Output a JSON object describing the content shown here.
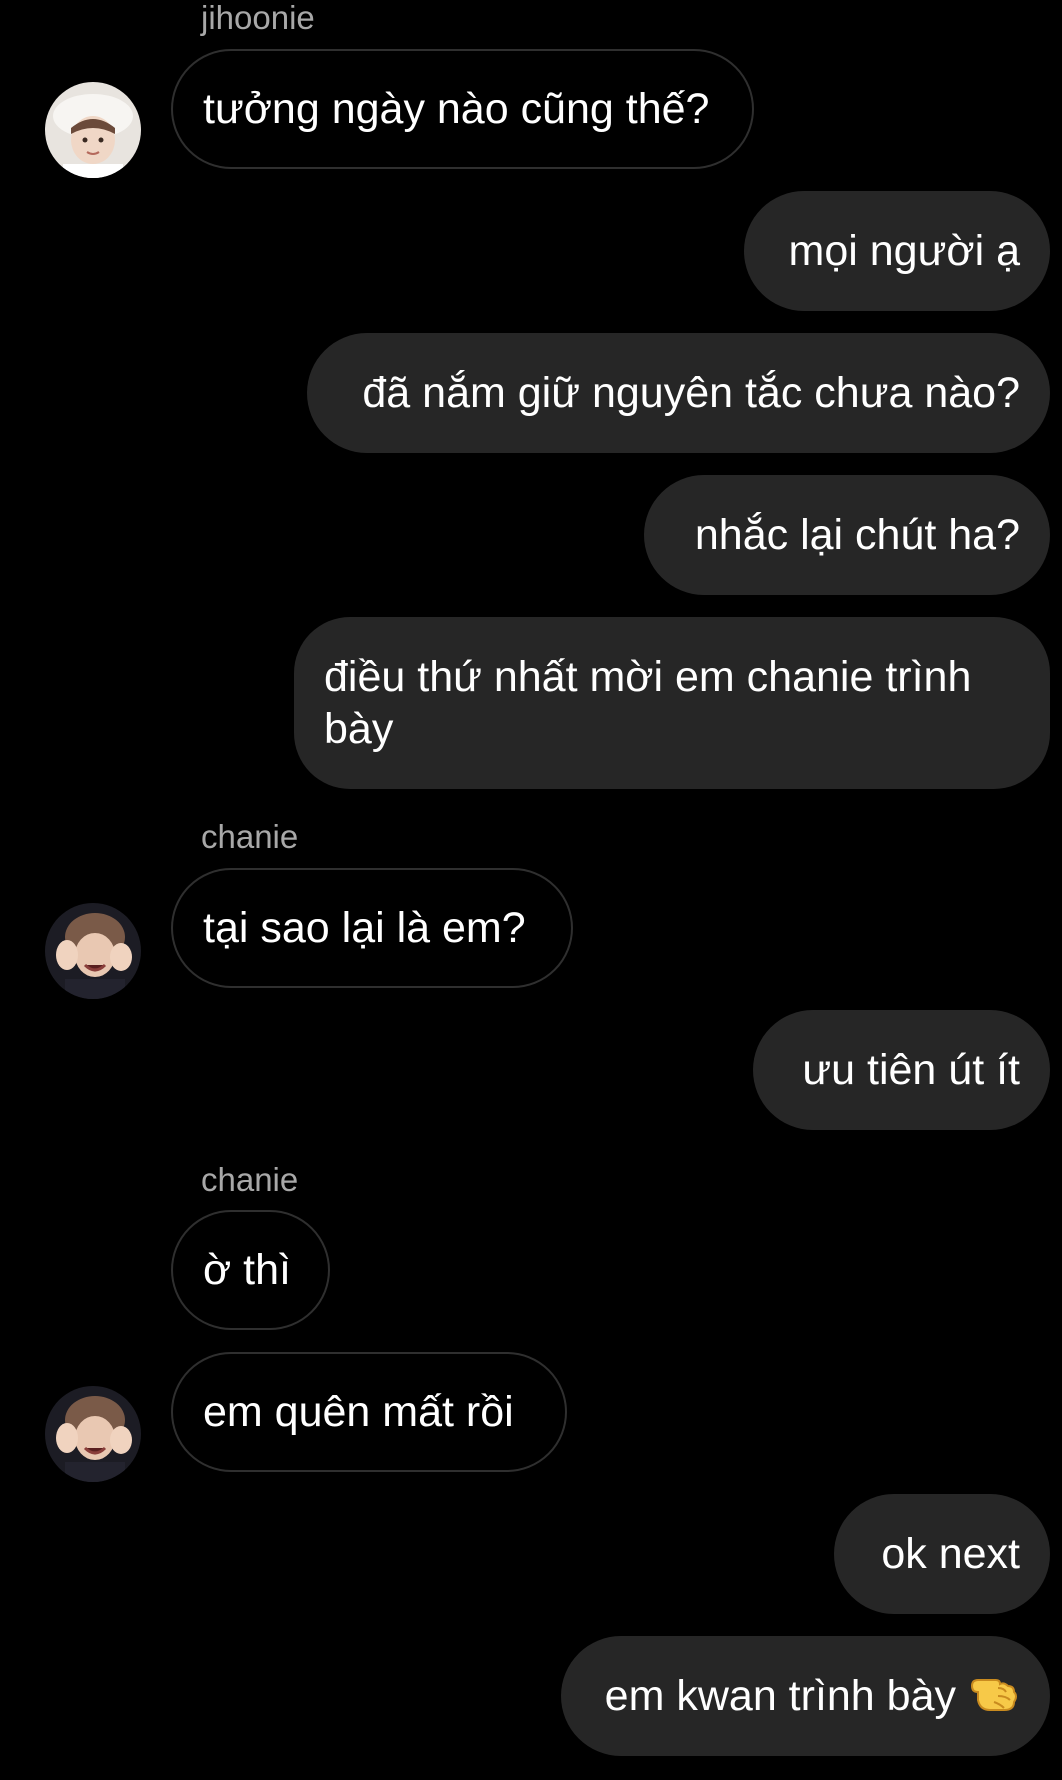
{
  "messages": [
    {
      "sender": "jihoonie",
      "text": "tưởng ngày nào cũng thế?"
    },
    {
      "text": "mọi người ạ"
    },
    {
      "text": "đã nắm giữ nguyên tắc chưa nào?"
    },
    {
      "text": "nhắc lại chút ha?"
    },
    {
      "text": "điều thứ nhất mời em chanie trình bày"
    },
    {
      "sender": "chanie",
      "text": "tại sao lại là em?"
    },
    {
      "text": "ưu tiên út ít"
    },
    {
      "sender": "chanie",
      "text": "ờ thì"
    },
    {
      "text": "em quên mất rồi"
    },
    {
      "text": "ok next"
    },
    {
      "text": "em kwan trình bày",
      "emoji": "backhand-index-pointing-left"
    }
  ],
  "colors": {
    "background": "#000000",
    "outgoing_bubble": "#262626",
    "incoming_border": "#2f2f2f",
    "sender_name": "#a8a8a8",
    "text": "#ffffff"
  }
}
